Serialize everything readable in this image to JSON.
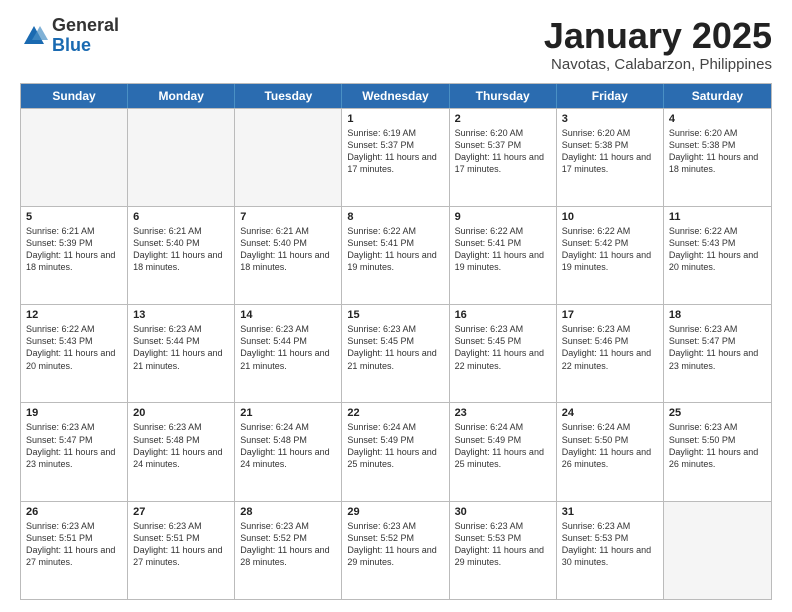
{
  "logo": {
    "general": "General",
    "blue": "Blue"
  },
  "title": "January 2025",
  "subtitle": "Navotas, Calabarzon, Philippines",
  "days": [
    "Sunday",
    "Monday",
    "Tuesday",
    "Wednesday",
    "Thursday",
    "Friday",
    "Saturday"
  ],
  "weeks": [
    [
      {
        "num": "",
        "info": ""
      },
      {
        "num": "",
        "info": ""
      },
      {
        "num": "",
        "info": ""
      },
      {
        "num": "1",
        "info": "Sunrise: 6:19 AM\nSunset: 5:37 PM\nDaylight: 11 hours and 17 minutes."
      },
      {
        "num": "2",
        "info": "Sunrise: 6:20 AM\nSunset: 5:37 PM\nDaylight: 11 hours and 17 minutes."
      },
      {
        "num": "3",
        "info": "Sunrise: 6:20 AM\nSunset: 5:38 PM\nDaylight: 11 hours and 17 minutes."
      },
      {
        "num": "4",
        "info": "Sunrise: 6:20 AM\nSunset: 5:38 PM\nDaylight: 11 hours and 18 minutes."
      }
    ],
    [
      {
        "num": "5",
        "info": "Sunrise: 6:21 AM\nSunset: 5:39 PM\nDaylight: 11 hours and 18 minutes."
      },
      {
        "num": "6",
        "info": "Sunrise: 6:21 AM\nSunset: 5:40 PM\nDaylight: 11 hours and 18 minutes."
      },
      {
        "num": "7",
        "info": "Sunrise: 6:21 AM\nSunset: 5:40 PM\nDaylight: 11 hours and 18 minutes."
      },
      {
        "num": "8",
        "info": "Sunrise: 6:22 AM\nSunset: 5:41 PM\nDaylight: 11 hours and 19 minutes."
      },
      {
        "num": "9",
        "info": "Sunrise: 6:22 AM\nSunset: 5:41 PM\nDaylight: 11 hours and 19 minutes."
      },
      {
        "num": "10",
        "info": "Sunrise: 6:22 AM\nSunset: 5:42 PM\nDaylight: 11 hours and 19 minutes."
      },
      {
        "num": "11",
        "info": "Sunrise: 6:22 AM\nSunset: 5:43 PM\nDaylight: 11 hours and 20 minutes."
      }
    ],
    [
      {
        "num": "12",
        "info": "Sunrise: 6:22 AM\nSunset: 5:43 PM\nDaylight: 11 hours and 20 minutes."
      },
      {
        "num": "13",
        "info": "Sunrise: 6:23 AM\nSunset: 5:44 PM\nDaylight: 11 hours and 21 minutes."
      },
      {
        "num": "14",
        "info": "Sunrise: 6:23 AM\nSunset: 5:44 PM\nDaylight: 11 hours and 21 minutes."
      },
      {
        "num": "15",
        "info": "Sunrise: 6:23 AM\nSunset: 5:45 PM\nDaylight: 11 hours and 21 minutes."
      },
      {
        "num": "16",
        "info": "Sunrise: 6:23 AM\nSunset: 5:45 PM\nDaylight: 11 hours and 22 minutes."
      },
      {
        "num": "17",
        "info": "Sunrise: 6:23 AM\nSunset: 5:46 PM\nDaylight: 11 hours and 22 minutes."
      },
      {
        "num": "18",
        "info": "Sunrise: 6:23 AM\nSunset: 5:47 PM\nDaylight: 11 hours and 23 minutes."
      }
    ],
    [
      {
        "num": "19",
        "info": "Sunrise: 6:23 AM\nSunset: 5:47 PM\nDaylight: 11 hours and 23 minutes."
      },
      {
        "num": "20",
        "info": "Sunrise: 6:23 AM\nSunset: 5:48 PM\nDaylight: 11 hours and 24 minutes."
      },
      {
        "num": "21",
        "info": "Sunrise: 6:24 AM\nSunset: 5:48 PM\nDaylight: 11 hours and 24 minutes."
      },
      {
        "num": "22",
        "info": "Sunrise: 6:24 AM\nSunset: 5:49 PM\nDaylight: 11 hours and 25 minutes."
      },
      {
        "num": "23",
        "info": "Sunrise: 6:24 AM\nSunset: 5:49 PM\nDaylight: 11 hours and 25 minutes."
      },
      {
        "num": "24",
        "info": "Sunrise: 6:24 AM\nSunset: 5:50 PM\nDaylight: 11 hours and 26 minutes."
      },
      {
        "num": "25",
        "info": "Sunrise: 6:23 AM\nSunset: 5:50 PM\nDaylight: 11 hours and 26 minutes."
      }
    ],
    [
      {
        "num": "26",
        "info": "Sunrise: 6:23 AM\nSunset: 5:51 PM\nDaylight: 11 hours and 27 minutes."
      },
      {
        "num": "27",
        "info": "Sunrise: 6:23 AM\nSunset: 5:51 PM\nDaylight: 11 hours and 27 minutes."
      },
      {
        "num": "28",
        "info": "Sunrise: 6:23 AM\nSunset: 5:52 PM\nDaylight: 11 hours and 28 minutes."
      },
      {
        "num": "29",
        "info": "Sunrise: 6:23 AM\nSunset: 5:52 PM\nDaylight: 11 hours and 29 minutes."
      },
      {
        "num": "30",
        "info": "Sunrise: 6:23 AM\nSunset: 5:53 PM\nDaylight: 11 hours and 29 minutes."
      },
      {
        "num": "31",
        "info": "Sunrise: 6:23 AM\nSunset: 5:53 PM\nDaylight: 11 hours and 30 minutes."
      },
      {
        "num": "",
        "info": ""
      }
    ]
  ]
}
